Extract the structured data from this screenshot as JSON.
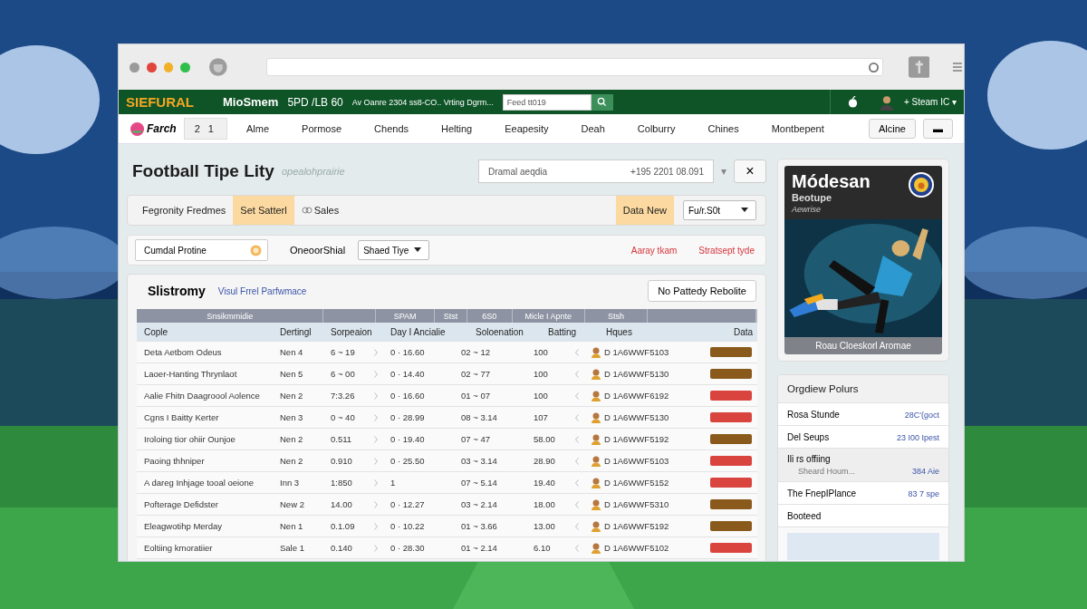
{
  "header": {
    "logo": "SIEFURAL",
    "brand": "MioSmem",
    "code": "5PD /LB 60",
    "tagline": "Av Oanre 2304 ss8-CO.. Vrting Dgrm...",
    "search": {
      "value": "Feed tt019"
    },
    "user": "+ Steam IC ▾"
  },
  "nav": {
    "logo": "Farch",
    "items": [
      {
        "label": "2 1",
        "selected": true
      },
      {
        "label": "Alme",
        "selected": false
      },
      {
        "label": "Pormose",
        "selected": false
      },
      {
        "label": "Chends",
        "selected": false
      },
      {
        "label": "Helting",
        "selected": false
      },
      {
        "label": "Eeapesity",
        "selected": false
      },
      {
        "label": "Deah",
        "selected": false
      },
      {
        "label": "Colburry",
        "selected": false
      },
      {
        "label": "Chines",
        "selected": false
      },
      {
        "label": "Montbepent",
        "selected": false
      }
    ],
    "buttons": [
      "Alcine",
      "▬"
    ]
  },
  "page": {
    "title": "Football Tipe Lity",
    "subtitle": "opealohprairie",
    "search": {
      "placeholder": "Dramal aeqdia",
      "value": "+195 2201 08.091"
    },
    "dropdown_caret": "▾",
    "close": "×"
  },
  "filters": {
    "chips": [
      {
        "label": "Fegronity Fredmes",
        "selected": false
      },
      {
        "label": "Set Satterl",
        "selected": true
      },
      {
        "label": "Sales",
        "selected": false
      }
    ],
    "action": "Data New",
    "select": "Fu/r.S0t"
  },
  "toolbar": {
    "field": {
      "value": "Cumdal Protine"
    },
    "label": "OneoorShial",
    "dropdown": "Shaed Tiye",
    "links": [
      "Aaray tkam",
      "Stratsept tyde"
    ]
  },
  "table": {
    "title": "Slistromy",
    "link": "Visul Frrel Parfwmace",
    "button": "No Pattedy Rebolite",
    "group_headers": [
      "Snsikmmidie",
      "SPAM",
      "Stst",
      "6S0",
      "Micle I Apnte",
      "Stsh"
    ],
    "columns": [
      "Cople",
      "Dertingl",
      "Sorpeaion",
      "Day I Ancialie",
      "Soloenation",
      "Batting",
      "Hques",
      "Data"
    ],
    "rows": [
      {
        "name": "Deta Aetbom Odeus",
        "rank": "Nen 4",
        "score": "6 ~ 19",
        "day": "0 · 16.60",
        "solo": "02 ~ 12",
        "batting": "100",
        "code": "D 1A6WWF5103",
        "color": "#8a5a1c"
      },
      {
        "name": "Laoer-Hanting Thrynlaot",
        "rank": "Nen 5",
        "score": "6 ~ 00",
        "day": "0 · 14.40",
        "solo": "02 ~ 77",
        "batting": "100",
        "code": "D 1A6WWF5130",
        "color": "#8a5a1c"
      },
      {
        "name": "Aalie Fhitn Daagroool Aolence",
        "rank": "Nen 2",
        "score": "7:3.26",
        "day": "0 · 16.60",
        "solo": "01 ~ 07",
        "batting": "100",
        "code": "D 1A6WWF6192",
        "color": "#d9443f"
      },
      {
        "name": "Cgns I Baitty Kerter",
        "rank": "Nen 3",
        "score": "0 ~ 40",
        "day": "0 · 28.99",
        "solo": "08 ~ 3.14",
        "batting": "107",
        "code": "D 1A6WWF5130",
        "color": "#d9443f"
      },
      {
        "name": "Iroloing tior ohiir Ounjoe",
        "rank": "Nen 2",
        "score": "0.511",
        "day": "0 · 19.40",
        "solo": "07 ~ 47",
        "batting": "58.00",
        "code": "D 1A6WWF5192",
        "color": "#8a5a1c"
      },
      {
        "name": "Paoing thhniper",
        "rank": "Nen 2",
        "score": "0.910",
        "day": "0 · 25.50",
        "solo": "03 ~ 3.14",
        "batting": "28.90",
        "code": "D 1A6WWF5103",
        "color": "#d9443f"
      },
      {
        "name": "A dareg Inhjage tooal oeione",
        "rank": "Inn 3",
        "score": "1:850",
        "day": "1",
        "solo": "07 ~ 5.14",
        "batting": "19.40",
        "code": "D 1A6WWF5152",
        "color": "#d9443f"
      },
      {
        "name": "Pofterage Defidster",
        "rank": "New 2",
        "score": "14.00",
        "day": "0 · 12.27",
        "solo": "03 ~ 2.14",
        "batting": "18.00",
        "code": "D 1A6WWF5310",
        "color": "#8a5a1c"
      },
      {
        "name": "Eleagwotihp Merday",
        "rank": "Nen 1",
        "score": "0.1.09",
        "day": "0 · 10.22",
        "solo": "01 ~ 3.66",
        "batting": "13.00",
        "code": "D 1A6WWF5192",
        "color": "#8a5a1c"
      },
      {
        "name": "Eoltiing kmoratiier",
        "rank": "Sale 1",
        "score": "0.140",
        "day": "0 · 28.30",
        "solo": "01 ~ 2.14",
        "batting": "6.10",
        "code": "D 1A6WWF5102",
        "color": "#d9443f"
      }
    ]
  },
  "promo": {
    "title": "Módesan",
    "subtitle": "Beotupe",
    "tag": "Aewrise",
    "caption": "Roau Cloeskorl Aromae"
  },
  "overview": {
    "title": "Orgdiew Polurs",
    "items": [
      {
        "label": "Rosa Stunde",
        "value": "28C'(goct",
        "selected": false
      },
      {
        "label": "Del Seups",
        "value": "23 I00 Ipest",
        "selected": false
      },
      {
        "label": "Ili rs offiing",
        "sub": "Sheard Houm...",
        "value": "384 Aie",
        "selected": true
      },
      {
        "label": "The FnepIPlance",
        "value": "83 7 spe",
        "selected": false
      },
      {
        "label": "Booteed",
        "selected": false
      }
    ]
  }
}
